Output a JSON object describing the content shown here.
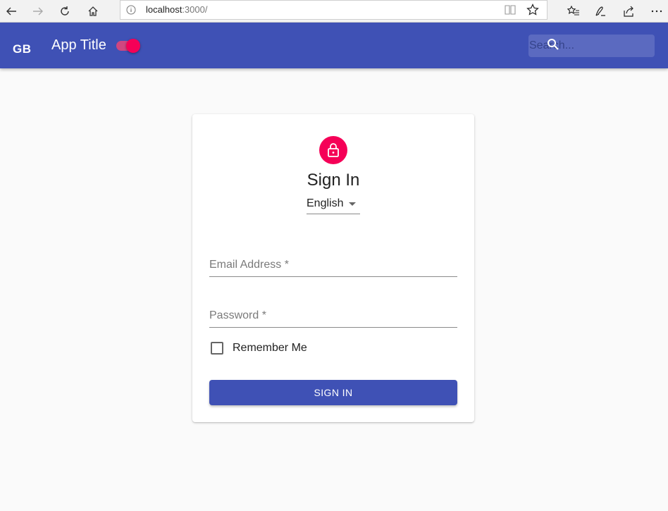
{
  "browser": {
    "url_host": "localhost",
    "url_rest": ":3000/"
  },
  "appbar": {
    "logo": "GB",
    "title": "App Title",
    "theme_switch_on": true,
    "search_placeholder": "Search..."
  },
  "signin": {
    "title": "Sign In",
    "language": "English",
    "email_label": "Email Address *",
    "password_label": "Password *",
    "remember_label": "Remember Me",
    "remember_checked": false,
    "button_label": "SIGN IN"
  },
  "colors": {
    "primary": "#3f51b5",
    "secondary": "#f50057",
    "background": "#fafafa"
  },
  "icons": [
    "back-icon",
    "forward-icon",
    "refresh-icon",
    "home-icon",
    "info-icon",
    "reading-view-icon",
    "favorite-star-icon",
    "favorites-list-icon",
    "pen-icon",
    "share-icon",
    "more-icon",
    "search-icon",
    "lock-icon",
    "dropdown-arrow-icon"
  ]
}
